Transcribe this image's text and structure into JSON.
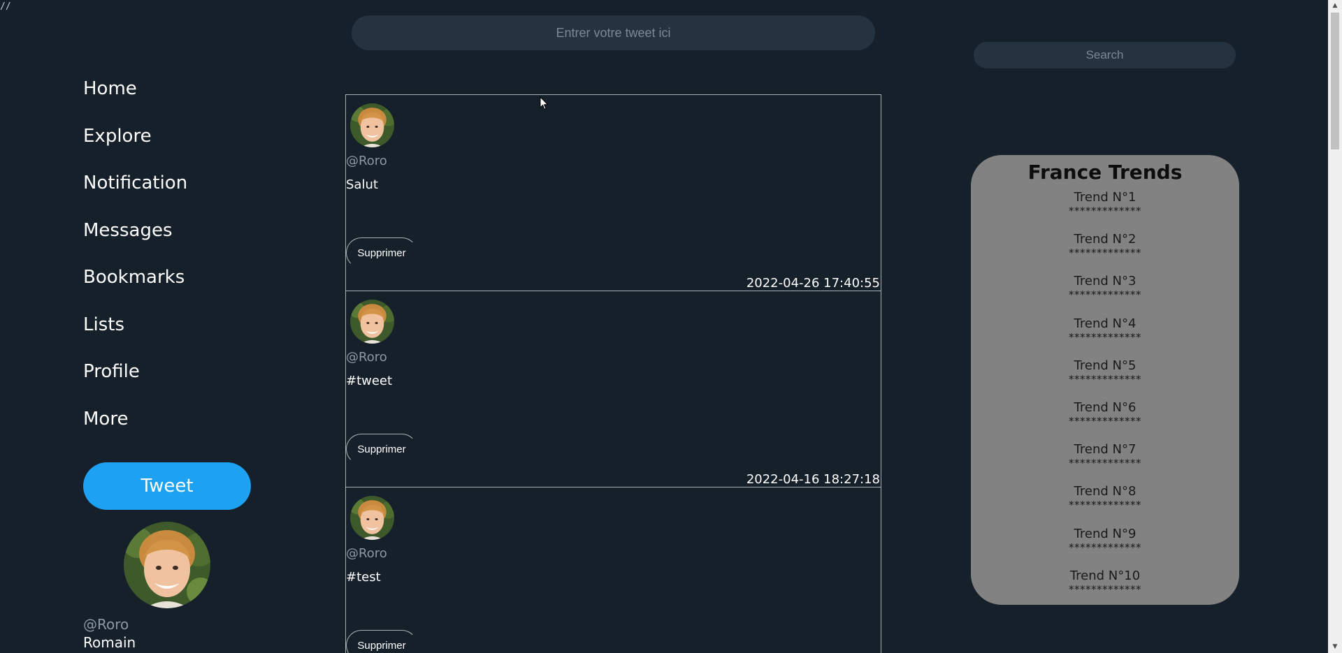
{
  "corner_mark": "//",
  "nav": {
    "items": [
      {
        "label": "Home"
      },
      {
        "label": "Explore"
      },
      {
        "label": "Notification"
      },
      {
        "label": "Messages"
      },
      {
        "label": "Bookmarks"
      },
      {
        "label": "Lists"
      },
      {
        "label": "Profile"
      },
      {
        "label": "More"
      }
    ],
    "tweet_button": "Tweet"
  },
  "profile": {
    "handle": "@Roro",
    "name": "Romain"
  },
  "composer": {
    "placeholder": "Entrer votre tweet ici"
  },
  "feed": {
    "delete_label": "Supprimer",
    "tweets": [
      {
        "handle": "@Roro",
        "text": "Salut",
        "date": "2022-04-26 17:40:55"
      },
      {
        "handle": "@Roro",
        "text": "#tweet",
        "date": "2022-04-16 18:27:18"
      },
      {
        "handle": "@Roro",
        "text": "#test",
        "date": ""
      }
    ]
  },
  "search": {
    "placeholder": "Search"
  },
  "trends": {
    "title": "France Trends",
    "items": [
      {
        "name": "Trend N°1",
        "stars": "*************"
      },
      {
        "name": "Trend N°2",
        "stars": "*************"
      },
      {
        "name": "Trend N°3",
        "stars": "*************"
      },
      {
        "name": "Trend N°4",
        "stars": "*************"
      },
      {
        "name": "Trend N°5",
        "stars": "*************"
      },
      {
        "name": "Trend N°6",
        "stars": "*************"
      },
      {
        "name": "Trend N°7",
        "stars": "*************"
      },
      {
        "name": "Trend N°8",
        "stars": "*************"
      },
      {
        "name": "Trend N°9",
        "stars": "*************"
      },
      {
        "name": "Trend N°10",
        "stars": "*************"
      }
    ]
  },
  "colors": {
    "background": "#16202b",
    "accent": "#1da1f2",
    "trends_panel": "#828282",
    "muted_text": "#8b98a5"
  }
}
